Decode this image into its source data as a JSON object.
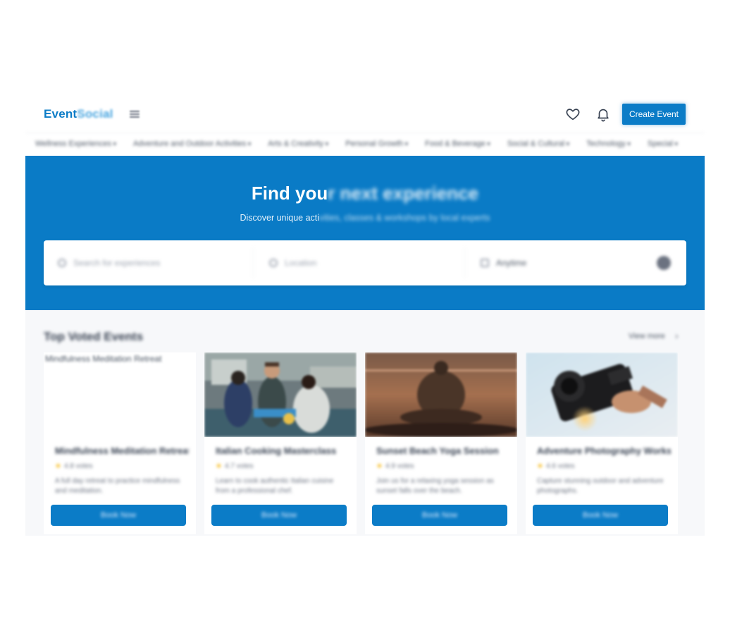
{
  "header": {
    "logo_primary": "Event",
    "logo_secondary": "Social",
    "create_button": "Create Event"
  },
  "categories": [
    "Wellness Experiences",
    "Adventure and Outdoor Activities",
    "Arts & Creativity",
    "Personal Growth",
    "Food & Beverage",
    "Social & Cultural",
    "Technology",
    "Special"
  ],
  "hero": {
    "title_clear": "Find you",
    "title_faded": "r next experience",
    "subtitle_clear": "Discover unique acti",
    "subtitle_faded": "vities, classes & workshops by local experts",
    "search_placeholder": "Search for experiences",
    "location_placeholder": "Location",
    "date_value": "Anytime"
  },
  "section": {
    "title": "Top Voted Events",
    "view_all": "View more"
  },
  "events": [
    {
      "image_alt": "Mindfulness Meditation Retreat",
      "title": "Mindfulness Meditation Retreat",
      "rating": "4.8 votes",
      "description": "A full day retreat to practice mindfulness and meditation.",
      "button": "Book Now"
    },
    {
      "image_alt": "",
      "title": "Italian Cooking Masterclass",
      "rating": "4.7 votes",
      "description": "Learn to cook authentic Italian cuisine from a professional chef.",
      "button": "Book Now"
    },
    {
      "image_alt": "",
      "title": "Sunset Beach Yoga Session",
      "rating": "4.9 votes",
      "description": "Join us for a relaxing yoga session as sunset falls over the beach.",
      "button": "Book Now"
    },
    {
      "image_alt": "",
      "title": "Adventure Photography Workshop",
      "rating": "4.6 votes",
      "description": "Capture stunning outdoor and adventure photographs.",
      "button": "Book Now"
    }
  ],
  "colors": {
    "brand": "#0b7cc7",
    "star": "#f5b50a",
    "section_bg": "#f7f8fa"
  }
}
